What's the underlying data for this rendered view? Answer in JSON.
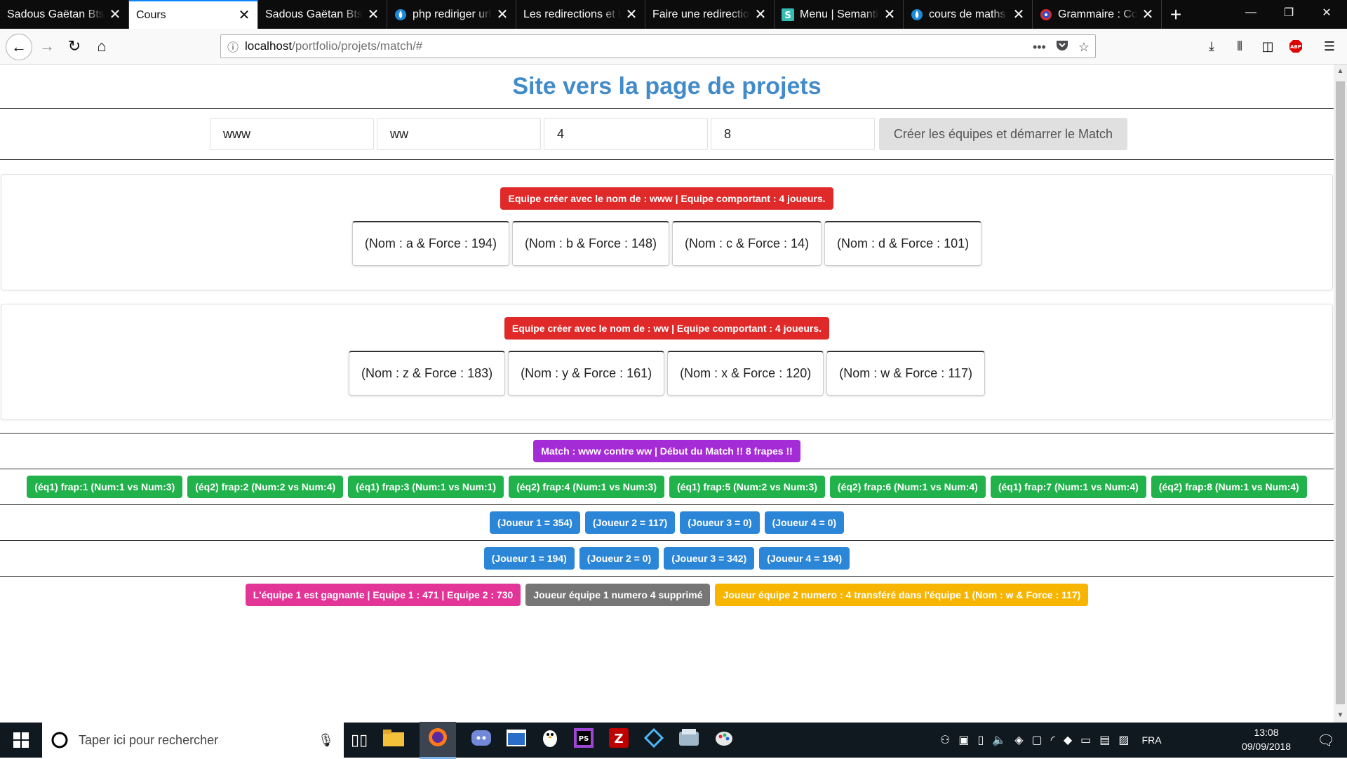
{
  "browser": {
    "tabs": [
      {
        "title": "Sadous Gaëtan Bts SIO",
        "active": false,
        "icon": "none"
      },
      {
        "title": "Cours",
        "active": true,
        "icon": "none"
      },
      {
        "title": "Sadous Gaëtan Bts SIO",
        "active": false,
        "icon": "none"
      },
      {
        "title": "php rediriger url",
        "active": false,
        "icon": "drop"
      },
      {
        "title": "Les redirections et l'UR",
        "active": false,
        "icon": "none"
      },
      {
        "title": "Faire une redirection",
        "active": false,
        "icon": "none"
      },
      {
        "title": "Menu | Semantic UI",
        "active": false,
        "icon": "S"
      },
      {
        "title": "cours de maths",
        "active": false,
        "icon": "drop"
      },
      {
        "title": "Grammaire : Cours",
        "active": false,
        "icon": "swirl"
      }
    ],
    "url_host": "localhost",
    "url_path": "/portfolio/projets/match/#"
  },
  "page": {
    "title": "Site vers la page de projets",
    "form": {
      "team1_name": "www",
      "team2_name": "ww",
      "players_count": "4",
      "hits_count": "8",
      "submit_label": "Créer les équipes et démarrer le Match"
    },
    "team1": {
      "badge": "Equipe créer avec le nom de : www | Equipe comportant : 4 joueurs.",
      "players": [
        "(Nom : a & Force : 194)",
        "(Nom : b & Force : 148)",
        "(Nom : c & Force : 14)",
        "(Nom : d & Force : 101)"
      ]
    },
    "team2": {
      "badge": "Equipe créer avec le nom de : ww | Equipe comportant : 4 joueurs.",
      "players": [
        "(Nom : z & Force : 183)",
        "(Nom : y & Force : 161)",
        "(Nom : x & Force : 120)",
        "(Nom : w & Force : 117)"
      ]
    },
    "match_badge": "Match : www contre ww | Début du Match !! 8 frapes !!",
    "hits": [
      "(éq1) frap:1 (Num:1 vs Num:3)",
      "(éq2) frap:2 (Num:2 vs Num:4)",
      "(éq1) frap:3 (Num:1 vs Num:1)",
      "(éq2) frap:4 (Num:1 vs Num:3)",
      "(éq1) frap:5 (Num:2 vs Num:3)",
      "(éq2) frap:6 (Num:1 vs Num:4)",
      "(éq1) frap:7 (Num:1 vs Num:4)",
      "(éq2) frap:8 (Num:1 vs Num:4)"
    ],
    "scores1": [
      "(Joueur 1 = 354)",
      "(Joueur 2 = 117)",
      "(Joueur 3 = 0)",
      "(Joueur 4 = 0)"
    ],
    "scores2": [
      "(Joueur 1 = 194)",
      "(Joueur 2 = 0)",
      "(Joueur 3 = 342)",
      "(Joueur 4 = 194)"
    ],
    "result": {
      "winner": "L'équipe 1 est gagnante | Equipe 1 : 471 | Equipe 2 : 730",
      "removed": "Joueur équipe 1 numero 4 supprimé",
      "transfer": "Joueur équipe 2 numero : 4 transféré dans l'équipe 1 (Nom : w & Force : 117)"
    }
  },
  "taskbar": {
    "search_placeholder": "Taper ici pour rechercher",
    "lang": "FRA",
    "time": "13:08",
    "date": "09/09/2018"
  }
}
